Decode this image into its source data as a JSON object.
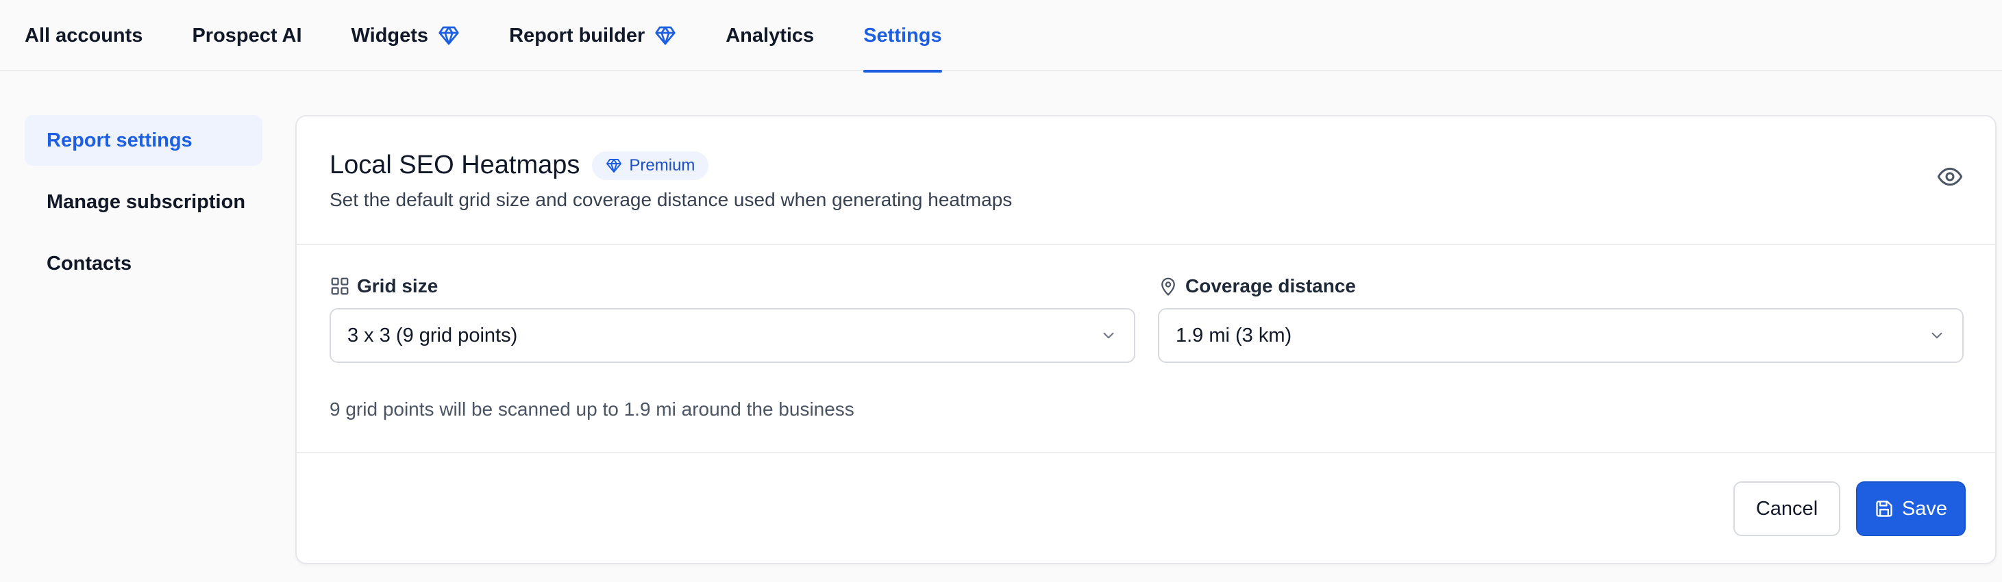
{
  "nav": {
    "tabs": [
      {
        "label": "All accounts",
        "premium": false
      },
      {
        "label": "Prospect AI",
        "premium": false
      },
      {
        "label": "Widgets",
        "premium": true
      },
      {
        "label": "Report builder",
        "premium": true
      },
      {
        "label": "Analytics",
        "premium": false
      },
      {
        "label": "Settings",
        "premium": false,
        "active": true
      }
    ]
  },
  "sidebar": {
    "items": [
      {
        "label": "Report settings",
        "active": true
      },
      {
        "label": "Manage subscription"
      },
      {
        "label": "Contacts"
      }
    ]
  },
  "card": {
    "title": "Local SEO Heatmaps",
    "badge": "Premium",
    "subtitle": "Set the default grid size and coverage distance used when generating heatmaps",
    "grid_field": {
      "label": "Grid size",
      "icon": "grid-icon",
      "value": "3 x 3 (9 grid points)"
    },
    "coverage_field": {
      "label": "Coverage distance",
      "icon": "map-pin-icon",
      "value": "1.9 mi (3 km)"
    },
    "helper": "9 grid points will be scanned up to 1.9 mi around the business",
    "cancel_label": "Cancel",
    "save_label": "Save"
  },
  "colors": {
    "accent": "#1d5fe0",
    "accent_soft": "#eef3fd",
    "border": "#d7dbe0"
  }
}
